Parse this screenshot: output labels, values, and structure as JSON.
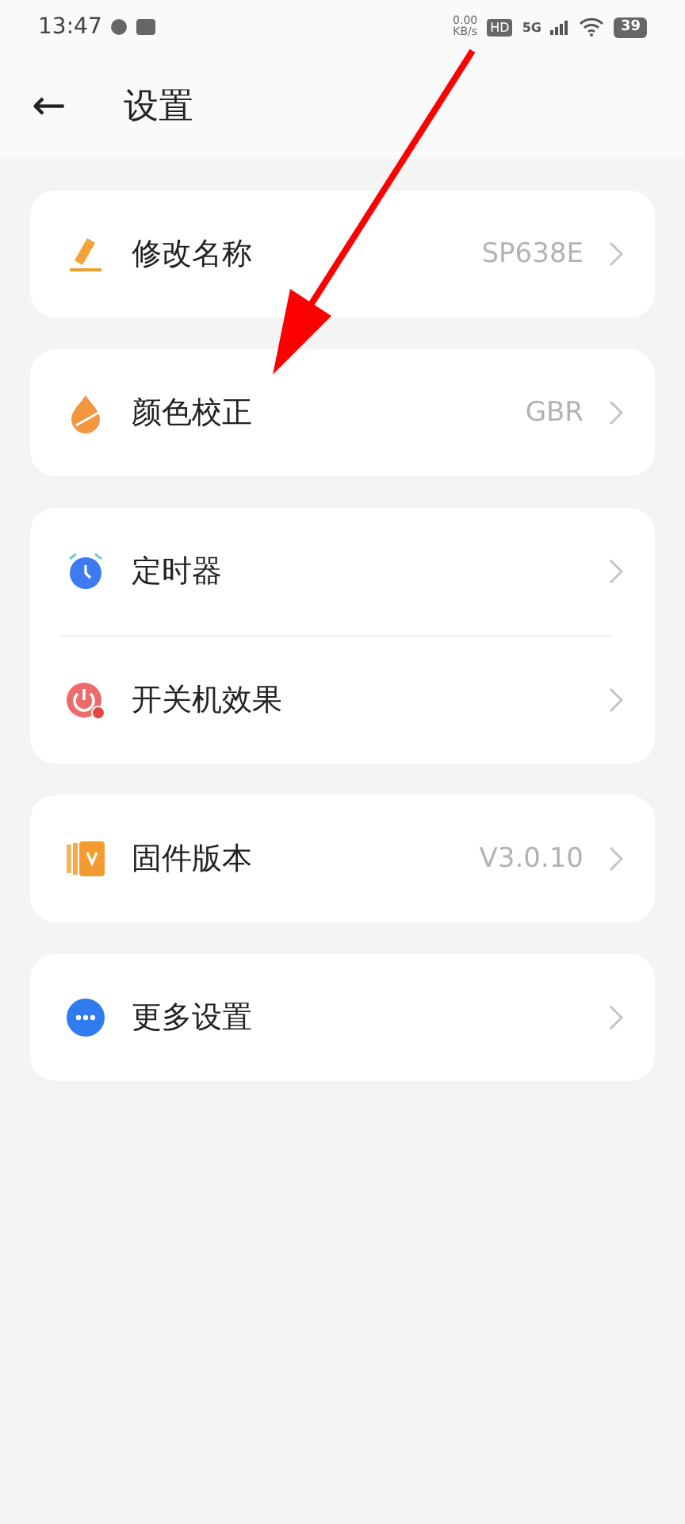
{
  "status_bar": {
    "time": "13:47",
    "net_speed": "0.00",
    "net_unit": "KB/s",
    "hd": "HD",
    "network": "5G",
    "battery": "39"
  },
  "header": {
    "back": "←",
    "title": "设置"
  },
  "groups": [
    {
      "rows": [
        {
          "kind": "pencil",
          "label": "修改名称",
          "value": "SP638E"
        }
      ]
    },
    {
      "rows": [
        {
          "kind": "drop",
          "label": "颜色校正",
          "value": "GBR"
        }
      ]
    },
    {
      "rows": [
        {
          "kind": "alarm",
          "label": "定时器"
        },
        {
          "kind": "power",
          "label": "开关机效果"
        }
      ]
    },
    {
      "rows": [
        {
          "kind": "version",
          "label": "固件版本",
          "value": "V3.0.10"
        }
      ]
    },
    {
      "rows": [
        {
          "kind": "more",
          "label": "更多设置"
        }
      ]
    }
  ],
  "annotation": {
    "kind": "arrow"
  }
}
